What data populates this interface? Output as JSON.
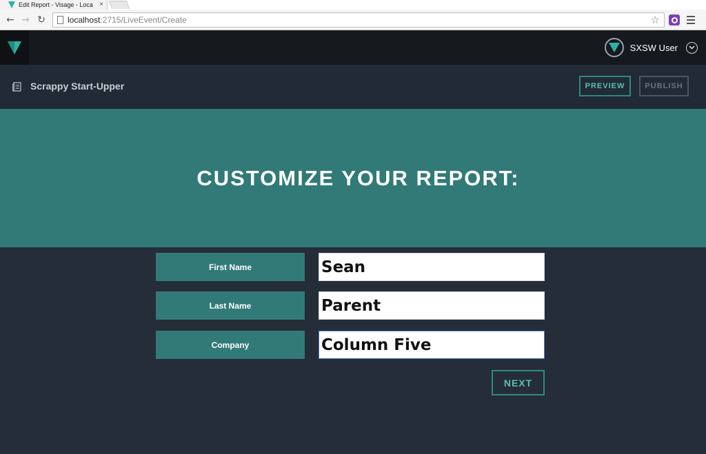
{
  "browser": {
    "tab_title": "Edit Report - Visage - Loca",
    "tab_close": "×",
    "url_host": "localhost",
    "url_path": ":2715/LiveEvent/Create",
    "back_glyph": "←",
    "forward_glyph": "→",
    "reload_glyph": "↻",
    "star_glyph": "☆"
  },
  "header": {
    "user_name": "SXSW User"
  },
  "subheader": {
    "project_name": "Scrappy Start-Upper",
    "preview_label": "PREVIEW",
    "publish_label": "PUBLISH"
  },
  "hero": {
    "title": "CUSTOMIZE YOUR REPORT:"
  },
  "form": {
    "fields": [
      {
        "label": "First Name",
        "value": "Sean"
      },
      {
        "label": "Last Name",
        "value": "Parent"
      },
      {
        "label": "Company",
        "value": "Column Five"
      }
    ],
    "next_label": "NEXT"
  },
  "colors": {
    "teal": "#317a77",
    "accent": "#57c0b5",
    "background": "#242d38",
    "header": "#16191d",
    "subheader": "#212a35"
  },
  "icons": {
    "logo": "visage-logo-icon",
    "project": "document-icon",
    "user_menu": "chevron-down-icon"
  }
}
